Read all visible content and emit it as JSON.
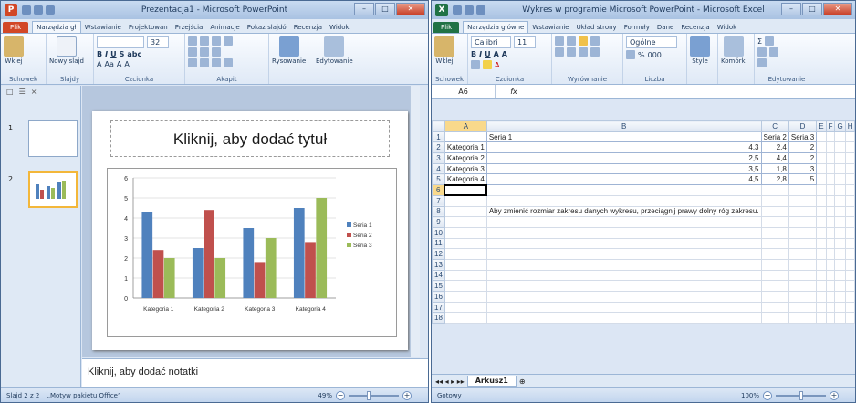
{
  "powerpoint": {
    "title": "Prezentacja1 - Microsoft PowerPoint",
    "app_icon": "P",
    "tabs": [
      "Plik",
      "Narzędzia gł",
      "Wstawianie",
      "Projektowan",
      "Przejścia",
      "Animacje",
      "Pokaz slajdó",
      "Recenzja",
      "Widok"
    ],
    "ribbon": {
      "paste_label": "Wklej",
      "new_slide_label": "Nowy slajd",
      "font_size": "32",
      "drawing_label": "Rysowanie",
      "editing_label": "Edytowanie",
      "groups": [
        "Schowek",
        "Slajdy",
        "Czcionka",
        "Akapit"
      ]
    },
    "thumb_tabs": [
      "□",
      "☰"
    ],
    "thumb_close": "×",
    "slide_numbers": [
      "1",
      "2"
    ],
    "slide_title_placeholder": "Kliknij, aby dodać tytuł",
    "notes_placeholder": "Kliknij, aby dodać notatki",
    "status": {
      "slide": "Slajd 2 z 2",
      "theme": "„Motyw pakietu Office”",
      "zoom": "49%"
    }
  },
  "chart_data": {
    "type": "bar",
    "categories": [
      "Kategoria 1",
      "Kategoria 2",
      "Kategoria 3",
      "Kategoria 4"
    ],
    "series": [
      {
        "name": "Seria 1",
        "values": [
          4.3,
          2.5,
          3.5,
          4.5
        ],
        "color": "#4f81bd"
      },
      {
        "name": "Seria 2",
        "values": [
          2.4,
          4.4,
          1.8,
          2.8
        ],
        "color": "#c0504d"
      },
      {
        "name": "Seria 3",
        "values": [
          2,
          2,
          3,
          5
        ],
        "color": "#9bbb59"
      }
    ],
    "legend_labels": [
      "Seria 1",
      "Seria 2",
      "Seria 3"
    ],
    "ylim": [
      0,
      6
    ],
    "yticks": [
      "0",
      "1",
      "2",
      "3",
      "4",
      "5",
      "6"
    ],
    "grid": true,
    "legend_position": "right"
  },
  "excel": {
    "title": "Wykres w programie Microsoft PowerPoint - Microsoft Excel",
    "app_icon": "X",
    "tabs": [
      "Plik",
      "Narzędzia główne",
      "Wstawianie",
      "Układ strony",
      "Formuły",
      "Dane",
      "Recenzja",
      "Widok"
    ],
    "ribbon": {
      "paste_label": "Wklej",
      "font_name": "Calibri",
      "font_size": "11",
      "number_format": "Ogólne",
      "styles_label": "Style",
      "cells_label": "Komórki",
      "groups": [
        "Schowek",
        "Czcionka",
        "Wyrównanie",
        "Liczba",
        "Edytowanie"
      ]
    },
    "name_box": "A6",
    "fx": "fx",
    "columns": [
      "A",
      "B",
      "C",
      "D",
      "E",
      "F",
      "G",
      "H",
      "I"
    ],
    "rows": [
      [
        "",
        "Seria 1",
        "Seria 2",
        "Seria 3",
        "",
        "",
        "",
        "",
        ""
      ],
      [
        "Kategoria 1",
        "4,3",
        "2,4",
        "2",
        "",
        "",
        "",
        "",
        ""
      ],
      [
        "Kategoria 2",
        "2,5",
        "4,4",
        "2",
        "",
        "",
        "",
        "",
        ""
      ],
      [
        "Kategoria 3",
        "3,5",
        "1,8",
        "3",
        "",
        "",
        "",
        "",
        ""
      ],
      [
        "Kategoria 4",
        "4,5",
        "2,8",
        "5",
        "",
        "",
        "",
        "",
        ""
      ],
      [
        "",
        "",
        "",
        "",
        "",
        "",
        "",
        "",
        ""
      ],
      [
        "",
        "",
        "",
        "",
        "",
        "",
        "",
        "",
        ""
      ],
      [
        "",
        "Aby zmienić rozmiar zakresu danych wykresu, przeciągnij prawy dolny róg zakresu.",
        "",
        "",
        "",
        "",
        "",
        "",
        ""
      ],
      [
        "",
        "",
        "",
        "",
        "",
        "",
        "",
        "",
        ""
      ],
      [
        "",
        "",
        "",
        "",
        "",
        "",
        "",
        "",
        ""
      ],
      [
        "",
        "",
        "",
        "",
        "",
        "",
        "",
        "",
        ""
      ],
      [
        "",
        "",
        "",
        "",
        "",
        "",
        "",
        "",
        ""
      ],
      [
        "",
        "",
        "",
        "",
        "",
        "",
        "",
        "",
        ""
      ],
      [
        "",
        "",
        "",
        "",
        "",
        "",
        "",
        "",
        ""
      ],
      [
        "",
        "",
        "",
        "",
        "",
        "",
        "",
        "",
        ""
      ],
      [
        "",
        "",
        "",
        "",
        "",
        "",
        "",
        "",
        ""
      ],
      [
        "",
        "",
        "",
        "",
        "",
        "",
        "",
        "",
        ""
      ],
      [
        "",
        "",
        "",
        "",
        "",
        "",
        "",
        "",
        ""
      ]
    ],
    "sheet_tab": "Arkusz1",
    "status": {
      "ready": "Gotowy",
      "zoom": "100%"
    }
  },
  "colors": {
    "ppt_accent": "#d24726",
    "excel_accent": "#207245"
  }
}
